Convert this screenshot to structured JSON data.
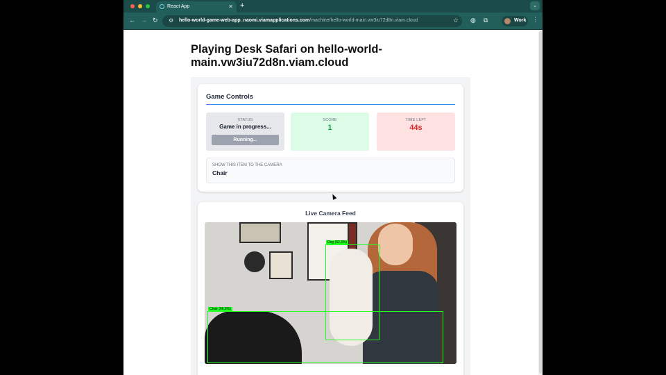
{
  "browser": {
    "tab_title": "React App",
    "new_tab": "+",
    "url_host": "hello-world-game-web-app_naomi.viamapplications.com",
    "url_path": "/machine/hello-world-main.vw3iu72d8n.viam.cloud",
    "profile_label": "Work"
  },
  "page": {
    "title": "Playing Desk Safari on hello-world-main.vw3iu72d8n.viam.cloud"
  },
  "controls": {
    "heading": "Game Controls",
    "status_label": "STATUS",
    "status_value": "Game in progress...",
    "run_button": "Running...",
    "score_label": "SCORE",
    "score_value": "1",
    "time_label": "TIME LEFT",
    "time_value": "44s",
    "target_label": "SHOW THIS ITEM TO THE CAMERA",
    "target_item": "Chair"
  },
  "feed": {
    "heading": "Live Camera Feed",
    "detections": [
      {
        "label": "Dog (62.3%)"
      },
      {
        "label": "Chair (66.8%)"
      }
    ]
  },
  "colors": {
    "chrome_tab_bar": "#1b4b48",
    "chrome_toolbar": "#235f5a",
    "accent_blue": "#3b82f6",
    "score_green": "#16a34a",
    "time_red": "#dc2626",
    "detection_green": "#22ff22"
  },
  "icons": [
    "close-icon",
    "back-icon",
    "forward-icon",
    "reload-icon",
    "tune-icon",
    "star-icon",
    "extensions-icon",
    "puzzle-icon",
    "kebab-icon",
    "cursor-icon"
  ]
}
